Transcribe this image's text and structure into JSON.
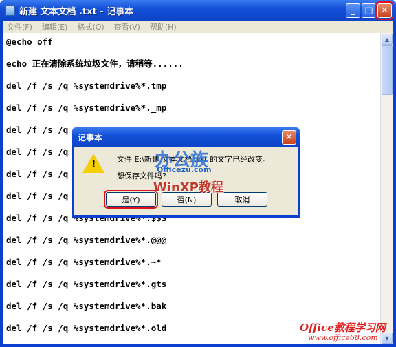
{
  "window": {
    "title": "新建 文本文档 .txt - 记事本",
    "min": "_",
    "max": "□",
    "close": "✕"
  },
  "menu": [
    "文件(F)",
    "编辑(E)",
    "格式(O)",
    "查看(V)",
    "帮助(H)"
  ],
  "lines": [
    "@echo off",
    "echo 正在清除系统垃圾文件，请稍等......",
    "del /f /s /q %systemdrive%*.tmp",
    "del /f /s /q %systemdrive%*._mp",
    "del /f /s /q",
    "del /f /s /q",
    "del /f /s /q",
    "del /f /s /q",
    "del /f /s /q %systemdrive%*.$$$",
    "del /f /s /q %systemdrive%*.@@@",
    "del /f /s /q %systemdrive%*.~*",
    "del /f /s /q %systemdrive%*.gts",
    "del /f /s /q %systemdrive%*.bak",
    "del /f /s /q %systemdrive%*.old"
  ],
  "dialog": {
    "title": "记事本",
    "message": "文件 E:\\新建 文本文档 .txt 的文字已经改变。",
    "question": "想保存文件吗?",
    "yes": "是(Y)",
    "no": "否(N)",
    "cancel": "取消",
    "icon": "warning-icon"
  },
  "watermarks": {
    "logo": "办公族",
    "site": "Officezu.com",
    "tagline": "WinXP教程",
    "corner": "Office教程学习网",
    "corner_url": "www.office68.com"
  },
  "colors": {
    "titlebar": "#0d44c8",
    "highlight": "#e0101a"
  }
}
